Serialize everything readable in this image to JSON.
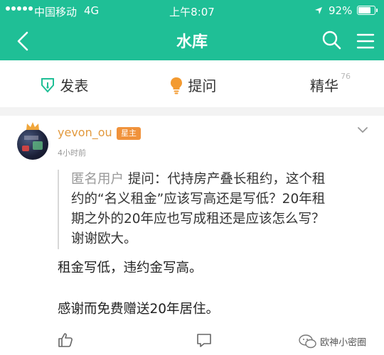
{
  "status_bar": {
    "carrier": "中国移动",
    "network": "4G",
    "time": "上午8:07",
    "battery": "92%",
    "battery_level": 0.92
  },
  "navbar": {
    "title": "水库",
    "back_icon": "chevron-left-icon",
    "search_icon": "search-icon",
    "menu_icon": "hamburger-menu-icon"
  },
  "tabs": [
    {
      "label": "发表",
      "icon": "pen-icon"
    },
    {
      "label": "提问",
      "icon": "lightbulb-icon"
    },
    {
      "label": "精华",
      "count": "76"
    }
  ],
  "post": {
    "author": "yevon_ou",
    "role_badge": "星主",
    "time": "4小时前",
    "question": {
      "asker": "匿名用户",
      "lines": [
        "提问：代持房产叠长租约，这个租",
        "约的“名义租金”应该写高还是写低？20年租",
        "期之外的20年应也写成租还是应该怎么写？",
        "谢谢欧大。"
      ]
    },
    "answer_lines": [
      "租金写低，违约金写高。",
      "感谢而免费赠送20年居住。"
    ]
  },
  "actions": {
    "like_icon": "thumbs-up-icon",
    "comment_icon": "comment-icon"
  },
  "watermark": {
    "text": "欧神小密圈",
    "icon": "wechat-icon"
  },
  "colors": {
    "header": "#1fbf96",
    "author": "#e2993d",
    "badge": "#f0923b",
    "muted": "#999999"
  }
}
